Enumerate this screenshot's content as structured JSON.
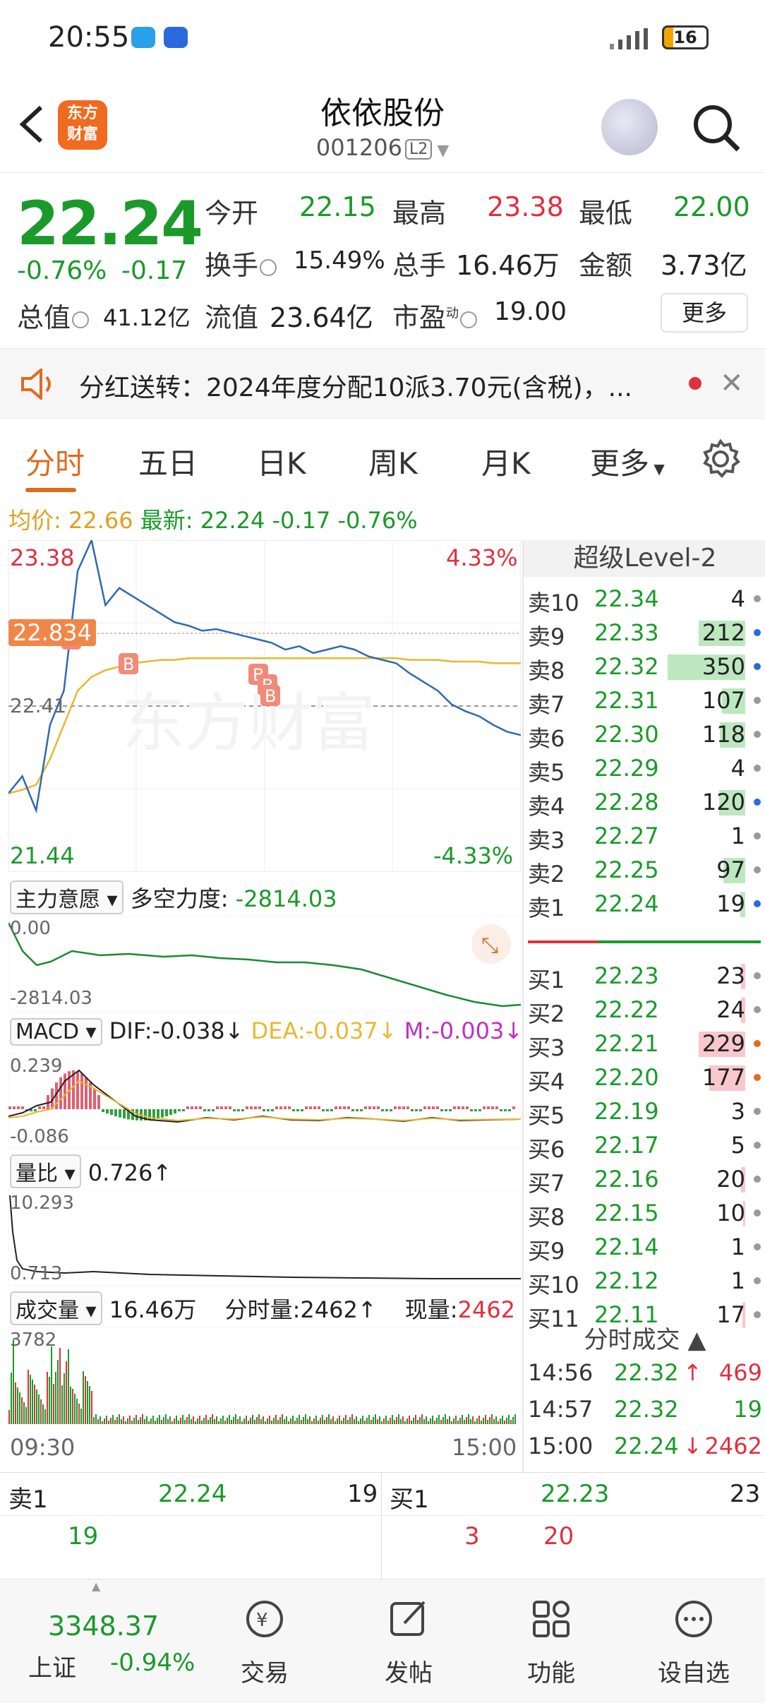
{
  "status_bar": {
    "time": "20:55",
    "battery": "16"
  },
  "header": {
    "title": "依依股份",
    "code": "001206",
    "level_badge": "L2",
    "logo_line1": "东方",
    "logo_line2": "财富"
  },
  "quote": {
    "price": "22.24",
    "change_pct": "-0.76%",
    "change": "-0.17",
    "open_label": "今开",
    "open": "22.15",
    "high_label": "最高",
    "high": "23.38",
    "low_label": "最低",
    "low": "22.00",
    "turnover_label": "换手",
    "turnover": "15.49%",
    "volume_label": "总手",
    "volume": "16.46万",
    "amount_label": "金额",
    "amount": "3.73亿",
    "total_mv_label": "总值",
    "total_mv": "41.12亿",
    "float_mv_label": "流值",
    "float_mv": "23.64亿",
    "pe_label": "市盈",
    "pe_sup": "动",
    "pe": "19.00",
    "more_button": "更多"
  },
  "news": {
    "text": "分红送转：2024年度分配10派3.70元(含税)，..."
  },
  "tabs": [
    "分时",
    "五日",
    "日K",
    "周K",
    "月K",
    "更多"
  ],
  "info_line": {
    "avg_label": "均价:",
    "avg": "22.66",
    "latest_label": "最新:",
    "latest": "22.24",
    "chg": "-0.17",
    "pct": "-0.76%"
  },
  "main_chart": {
    "y_high": "23.38",
    "y_low": "21.44",
    "pct_high": "4.33%",
    "pct_low": "-4.33%",
    "price_tag": "22.834",
    "mid_tag": "22.41",
    "watermark": "东方财富",
    "time_start": "09:30",
    "time_end": "15:00",
    "b_marker": "B"
  },
  "indicator1": {
    "selector": "主力意愿",
    "label": "多空力度:",
    "value": "-2814.03",
    "top": "0.00",
    "bottom": "-2814.03"
  },
  "indicator2": {
    "selector": "MACD",
    "dif": "DIF:-0.038↓",
    "dea": "DEA:-0.037↓",
    "m": "M:-0.003↓",
    "top": "0.239",
    "bottom": "-0.086"
  },
  "indicator3": {
    "selector": "量比",
    "value": "0.726↑",
    "top": "10.293",
    "bottom": "0.713"
  },
  "indicator4": {
    "selector": "成交量",
    "value": "16.46万",
    "fenshi_label": "分时量:",
    "fenshi": "2462↑",
    "now_label": "现量:",
    "now": "2462",
    "top": "3782"
  },
  "level2": {
    "title": "超级Level-2",
    "asks": [
      {
        "label": "卖10",
        "price": "22.34",
        "qty": "4",
        "bar": 0,
        "dot": "#999"
      },
      {
        "label": "卖9",
        "price": "22.33",
        "qty": "212",
        "bar": 0.6,
        "dot": "#2a6adf"
      },
      {
        "label": "卖8",
        "price": "22.32",
        "qty": "350",
        "bar": 1.0,
        "dot": "#2a6adf"
      },
      {
        "label": "卖7",
        "price": "22.31",
        "qty": "107",
        "bar": 0.3,
        "dot": "#999"
      },
      {
        "label": "卖6",
        "price": "22.30",
        "qty": "118",
        "bar": 0.33,
        "dot": "#999"
      },
      {
        "label": "卖5",
        "price": "22.29",
        "qty": "4",
        "bar": 0,
        "dot": "#999"
      },
      {
        "label": "卖4",
        "price": "22.28",
        "qty": "120",
        "bar": 0.34,
        "dot": "#2a6adf"
      },
      {
        "label": "卖3",
        "price": "22.27",
        "qty": "1",
        "bar": 0,
        "dot": "#999"
      },
      {
        "label": "卖2",
        "price": "22.25",
        "qty": "97",
        "bar": 0.28,
        "dot": "#999"
      },
      {
        "label": "卖1",
        "price": "22.24",
        "qty": "19",
        "bar": 0.06,
        "dot": "#2a6adf"
      }
    ],
    "bids": [
      {
        "label": "买1",
        "price": "22.23",
        "qty": "23",
        "bar": 0.05,
        "dot": "#999"
      },
      {
        "label": "买2",
        "price": "22.22",
        "qty": "24",
        "bar": 0.05,
        "dot": "#999"
      },
      {
        "label": "买3",
        "price": "22.21",
        "qty": "229",
        "bar": 0.6,
        "dot": "#e46a20"
      },
      {
        "label": "买4",
        "price": "22.20",
        "qty": "177",
        "bar": 0.46,
        "dot": "#e46a20"
      },
      {
        "label": "买5",
        "price": "22.19",
        "qty": "3",
        "bar": 0,
        "dot": "#999"
      },
      {
        "label": "买6",
        "price": "22.17",
        "qty": "5",
        "bar": 0,
        "dot": "#999"
      },
      {
        "label": "买7",
        "price": "22.16",
        "qty": "20",
        "bar": 0.05,
        "dot": "#999"
      },
      {
        "label": "买8",
        "price": "22.15",
        "qty": "10",
        "bar": 0.03,
        "dot": "#999"
      },
      {
        "label": "买9",
        "price": "22.14",
        "qty": "1",
        "bar": 0,
        "dot": "#999"
      },
      {
        "label": "买10",
        "price": "22.12",
        "qty": "1",
        "bar": 0,
        "dot": "#999"
      },
      {
        "label": "买11",
        "price": "22.11",
        "qty": "17",
        "bar": 0.04,
        "dot": "#999"
      }
    ],
    "trades_title": "分时成交",
    "trades": [
      {
        "time": "14:56",
        "price": "22.32",
        "arrow": "↑",
        "qty": "469",
        "pcolor": "#1a9a2a",
        "qcolor": "#e0303c"
      },
      {
        "time": "14:57",
        "price": "22.32",
        "arrow": "",
        "qty": "19",
        "pcolor": "#1a9a2a",
        "qcolor": "#1a9a2a"
      },
      {
        "time": "15:00",
        "price": "22.24",
        "arrow": "↓",
        "qty": "2462",
        "pcolor": "#1a9a2a",
        "qcolor": "#e0303c"
      }
    ]
  },
  "strip": {
    "ask_label": "卖1",
    "ask_price": "22.24",
    "ask_qty": "19",
    "bid_label": "买1",
    "bid_price": "22.23",
    "bid_qty": "23",
    "row2_a": "19",
    "row2_b": "3",
    "row2_c": "20"
  },
  "bottom_nav": {
    "index_value": "3348.37",
    "index_name": "上证",
    "index_change": "-0.94%",
    "items": [
      "交易",
      "发帖",
      "功能",
      "设自选"
    ]
  },
  "colors": {
    "up": "#e0303c",
    "down": "#1a9a2a",
    "accent": "#e06a20",
    "price_line": "#2e6ab0",
    "avg_line": "#e8b830"
  },
  "chart_data": {
    "type": "line",
    "series": [
      {
        "values": [
          21.9,
          22.0,
          21.8,
          22.3,
          22.5,
          23.2,
          23.38,
          23.0,
          23.1,
          23.05,
          23.0,
          22.95,
          22.9,
          22.88,
          22.85,
          22.86,
          22.84,
          22.82,
          22.8,
          22.78,
          22.74,
          22.76,
          22.72,
          22.74,
          22.76,
          22.74,
          22.7,
          22.68,
          22.66,
          22.6,
          22.55,
          22.5,
          22.42,
          22.38,
          22.35,
          22.3,
          22.26,
          22.24
        ]
      },
      {
        "values": [
          21.9,
          21.92,
          21.95,
          22.1,
          22.3,
          22.5,
          22.58,
          22.62,
          22.64,
          22.66,
          22.67,
          22.68,
          22.68,
          22.69,
          22.69,
          22.69,
          22.69,
          22.69,
          22.69,
          22.69,
          22.69,
          22.69,
          22.69,
          22.69,
          22.69,
          22.69,
          22.69,
          22.69,
          22.69,
          22.68,
          22.68,
          22.68,
          22.67,
          22.67,
          22.67,
          22.66,
          22.66,
          22.66
        ]
      }
    ],
    "ylim": [
      21.44,
      23.38
    ]
  }
}
